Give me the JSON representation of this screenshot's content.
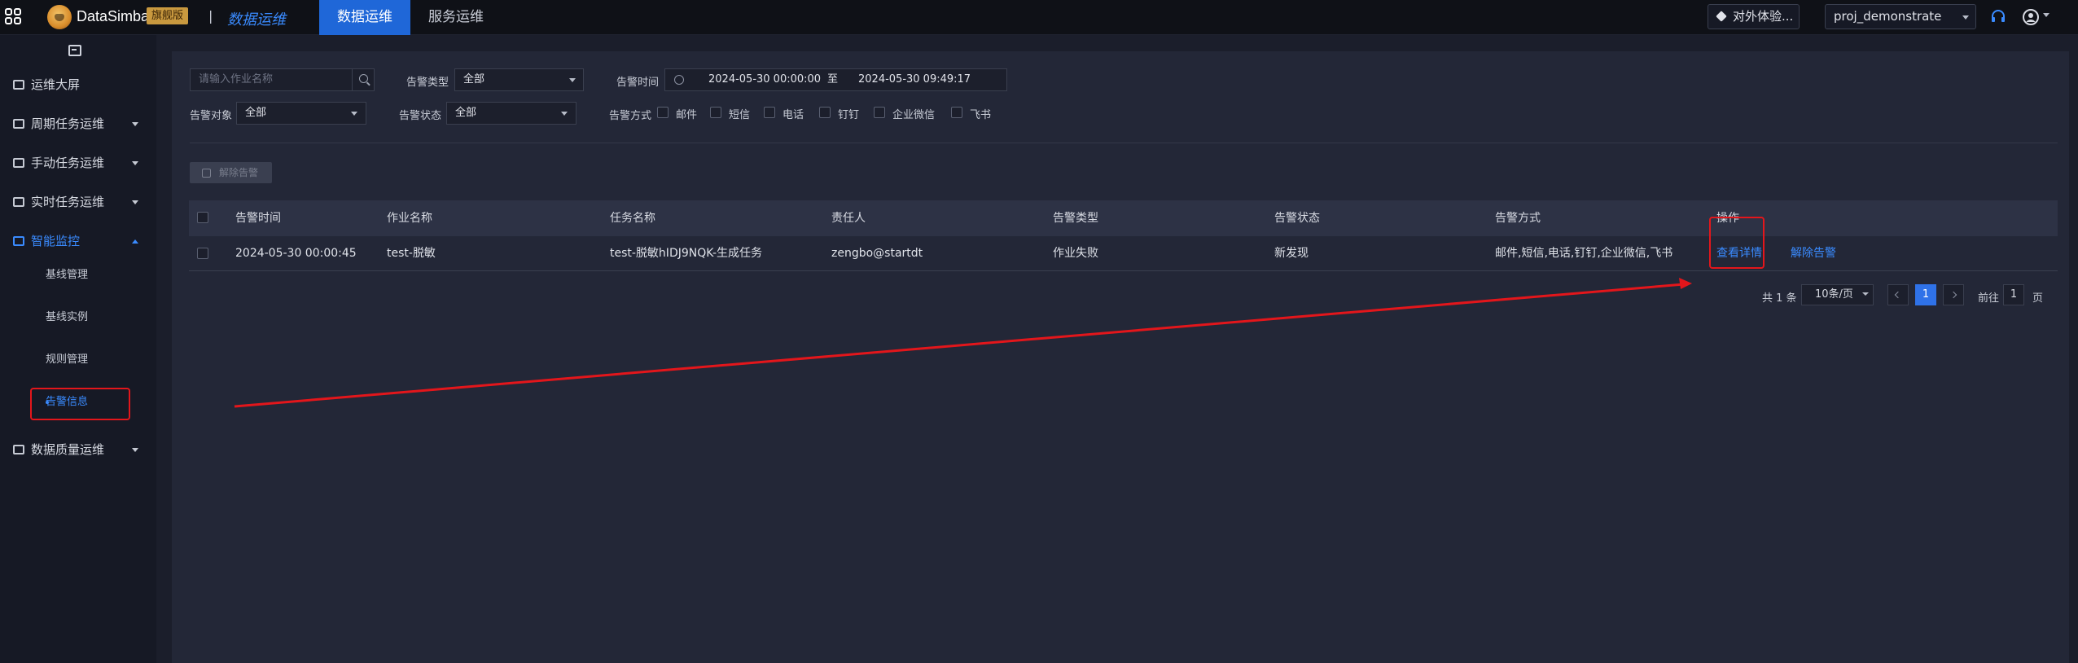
{
  "header": {
    "brand": "DataSimba",
    "brand_badge": "旗舰版",
    "separator": "|",
    "module": "数据运维",
    "tabs": [
      {
        "label": "数据运维",
        "active": true
      },
      {
        "label": "服务运维",
        "active": false
      }
    ],
    "experience_button": "对外体验...",
    "project_select": "proj_demonstrate",
    "accent": "#1f67d8"
  },
  "sidebar": {
    "items": [
      {
        "label": "运维大屏",
        "icon": "monitor-icon"
      },
      {
        "label": "周期任务运维",
        "icon": "calendar-icon"
      },
      {
        "label": "手动任务运维",
        "icon": "hand-task-icon"
      },
      {
        "label": "实时任务运维",
        "icon": "realtime-icon"
      },
      {
        "label": "智能监控",
        "icon": "monitor-alert-icon",
        "open": true
      },
      {
        "label": "数据质量运维",
        "icon": "quality-icon"
      }
    ],
    "sub_items": [
      {
        "label": "基线管理"
      },
      {
        "label": "基线实例"
      },
      {
        "label": "规则管理"
      },
      {
        "label": "告警信息",
        "active": true
      }
    ]
  },
  "filters": {
    "job_search_placeholder": "请输入作业名称",
    "alert_type_label": "告警类型",
    "alert_type_value": "全部",
    "alert_time_label": "告警时间",
    "time_start": "2024-05-30 00:00:00",
    "time_to": "至",
    "time_end": "2024-05-30 09:49:17",
    "alert_target_label": "告警对象",
    "alert_target_value": "全部",
    "alert_status_label": "告警状态",
    "alert_status_value": "全部",
    "alert_method_label": "告警方式",
    "methods": [
      "邮件",
      "短信",
      "电话",
      "钉钉",
      "企业微信",
      "飞书"
    ]
  },
  "actions": {
    "dismiss_label": "解除告警"
  },
  "table": {
    "columns": [
      "告警时间",
      "作业名称",
      "任务名称",
      "责任人",
      "告警类型",
      "告警状态",
      "告警方式",
      "操作"
    ],
    "rows": [
      {
        "time": "2024-05-30 00:00:45",
        "job": "test-脱敏",
        "task": "test-脱敏hIDJ9NQK-生成任务",
        "owner": "zengbo@startdt",
        "type": "作业失败",
        "status": "新发现",
        "methods": "邮件,短信,电话,钉钉,企业微信,飞书",
        "action_view": "查看详情",
        "action_dismiss": "解除告警"
      }
    ]
  },
  "pagination": {
    "total_text": "共 1 条",
    "page_size": "10条/页",
    "current_page": "1",
    "goto_label": "前往",
    "goto_value": "1",
    "page_unit": "页"
  },
  "annotation_color": "#e3161b"
}
